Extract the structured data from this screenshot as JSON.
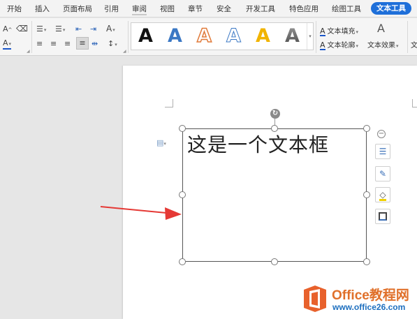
{
  "menu": {
    "tabs": [
      "开始",
      "插入",
      "页面布局",
      "引用",
      "审阅",
      "视图",
      "章节",
      "安全",
      "开发工具",
      "特色应用",
      "绘图工具",
      "文本工具"
    ],
    "active_tab": "文本工具"
  },
  "ribbon": {
    "style_glyph": "A",
    "text_fill_label": "文本填充",
    "text_outline_label": "文本轮廓",
    "text_effect_label": "文本效果",
    "overflow_label": "文"
  },
  "textbox": {
    "content": "这是一个文本框"
  },
  "watermark": {
    "brand": "Office教程网",
    "site": "www.office26.com"
  },
  "colors": {
    "active_tab_bg": "#1e6fd9",
    "arrow": "#e53935",
    "logo_orange": "#e0702a",
    "logo_blue": "#1d6fbf",
    "underline_blue": "#1a56c8"
  },
  "icons": [
    "font-size-increase-icon",
    "clear-format-icon",
    "font-color-icon",
    "bullet-list-icon",
    "numbered-list-icon",
    "decrease-indent-icon",
    "increase-indent-icon",
    "text-direction-icon",
    "align-left-icon",
    "align-center-icon",
    "align-right-icon",
    "justify-icon",
    "distribute-icon",
    "line-spacing-icon",
    "anchor-icon",
    "rotate-handle-icon",
    "collapse-icon",
    "layout-options-icon",
    "pen-icon",
    "fill-icon",
    "border-icon"
  ]
}
